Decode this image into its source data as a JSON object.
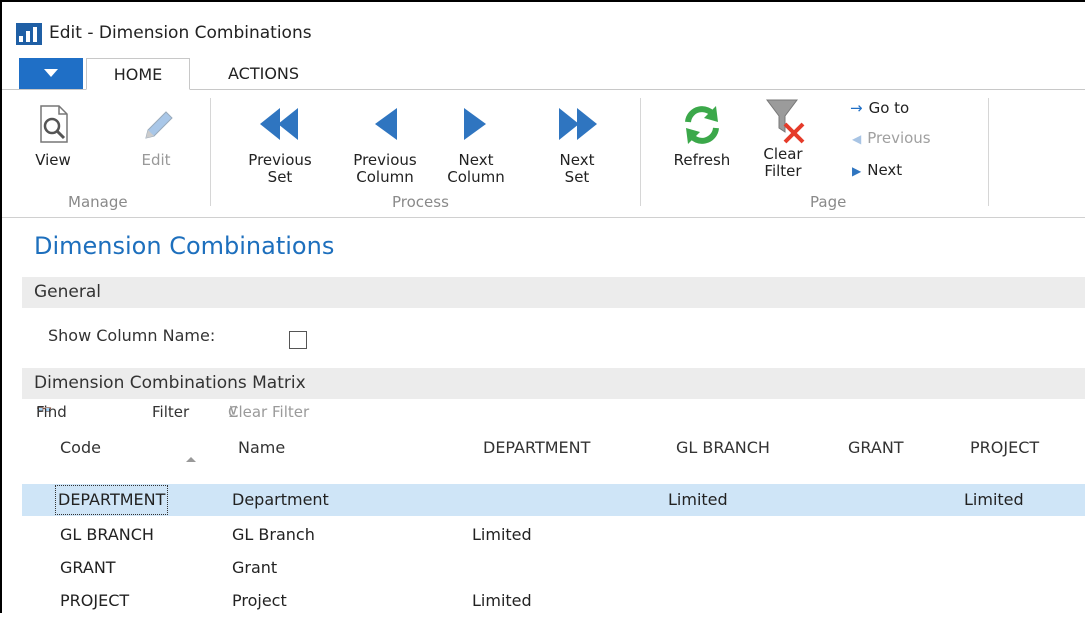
{
  "window": {
    "title": "Edit - Dimension Combinations"
  },
  "ribbon": {
    "tabs": [
      "HOME",
      "ACTIONS"
    ],
    "manage": {
      "label": "Manage",
      "view": "View",
      "edit": "Edit"
    },
    "process": {
      "label": "Process",
      "previous_set": [
        "Previous",
        "Set"
      ],
      "previous_column": [
        "Previous",
        "Column"
      ],
      "next_column": [
        "Next",
        "Column"
      ],
      "next_set": [
        "Next",
        "Set"
      ]
    },
    "page": {
      "label": "Page",
      "refresh": "Refresh",
      "clear_filter": [
        "Clear",
        "Filter"
      ],
      "go_to": "Go to",
      "previous": "Previous",
      "next": "Next"
    }
  },
  "page": {
    "title": "Dimension Combinations",
    "general": {
      "heading": "General",
      "show_column_name_label": "Show Column Name:",
      "show_column_name_checked": false
    },
    "matrix": {
      "heading": "Dimension Combinations Matrix",
      "toolbar": {
        "find": "Find",
        "filter": "Filter",
        "clear_filter": "Clear Filter"
      },
      "columns": [
        "Code",
        "Name",
        "DEPARTMENT",
        "GL BRANCH",
        "GRANT",
        "PROJECT"
      ],
      "rows": [
        {
          "code": "DEPARTMENT",
          "name": "Department",
          "department": "",
          "gl_branch": "Limited",
          "grant": "",
          "project": "Limited"
        },
        {
          "code": "GL BRANCH",
          "name": "GL Branch",
          "department": "Limited",
          "gl_branch": "",
          "grant": "",
          "project": ""
        },
        {
          "code": "GRANT",
          "name": "Grant",
          "department": "",
          "gl_branch": "",
          "grant": "",
          "project": ""
        },
        {
          "code": "PROJECT",
          "name": "Project",
          "department": "Limited",
          "gl_branch": "",
          "grant": "",
          "project": ""
        }
      ]
    }
  },
  "colors": {
    "accent": "#1d6fbd",
    "selection": "#cfe5f7",
    "section_bg": "#ececec"
  }
}
